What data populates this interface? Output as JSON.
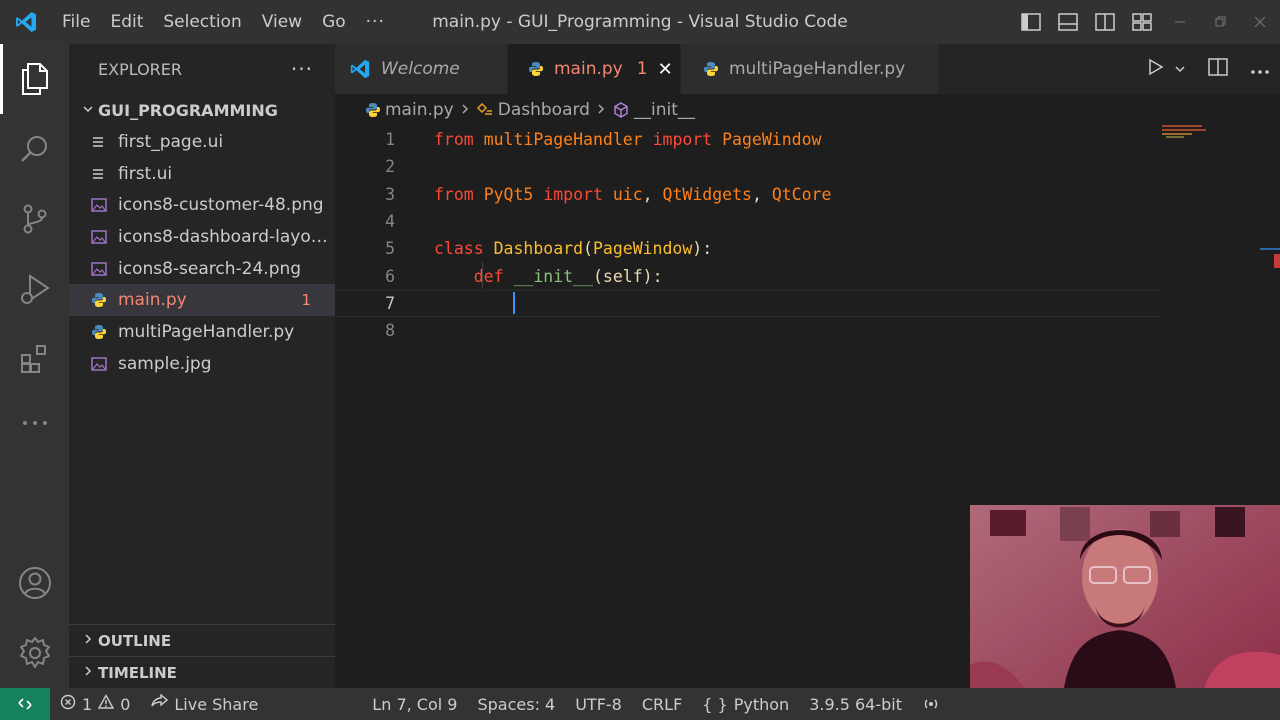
{
  "window": {
    "title": "main.py - GUI_Programming - Visual Studio Code"
  },
  "menu": {
    "items": [
      "File",
      "Edit",
      "Selection",
      "View",
      "Go"
    ],
    "more": "···"
  },
  "sidebar": {
    "header": "EXPLORER",
    "more": "···",
    "folder": "GUI_PROGRAMMING",
    "files": [
      {
        "name": "first_page.ui",
        "icon": "lines-icon"
      },
      {
        "name": "first.ui",
        "icon": "lines-icon"
      },
      {
        "name": "icons8-customer-48.png",
        "icon": "image-icon"
      },
      {
        "name": "icons8-dashboard-layou...",
        "icon": "image-icon"
      },
      {
        "name": "icons8-search-24.png",
        "icon": "image-icon"
      },
      {
        "name": "main.py",
        "icon": "python-icon",
        "badge": "1"
      },
      {
        "name": "multiPageHandler.py",
        "icon": "python-icon"
      },
      {
        "name": "sample.jpg",
        "icon": "image-icon"
      }
    ],
    "sections": [
      "OUTLINE",
      "TIMELINE"
    ]
  },
  "tabs": [
    {
      "label": "Welcome",
      "icon": "vscode-icon"
    },
    {
      "label": "main.py",
      "icon": "python-icon",
      "badge": "1",
      "close": "✕"
    },
    {
      "label": "multiPageHandler.py",
      "icon": "python-icon"
    }
  ],
  "breadcrumb": {
    "file": "main.py",
    "class": "Dashboard",
    "method": "__init__"
  },
  "code": {
    "line_numbers": [
      "1",
      "2",
      "3",
      "4",
      "5",
      "6",
      "7",
      "8"
    ],
    "line1": {
      "a": "from",
      "b": "multiPageHandler",
      "c": "import",
      "d": "PageWindow"
    },
    "line3": {
      "a": "from",
      "b": "PyQt5",
      "c": "import",
      "d": "uic",
      "e": "QtWidgets",
      "f": "QtCore"
    },
    "line5": {
      "a": "class",
      "b": "Dashboard",
      "c": "PageWindow"
    },
    "line6": {
      "a": "def",
      "b": "__init__",
      "c": "self"
    }
  },
  "status": {
    "errors": "1",
    "warnings": "0",
    "live_share": "Live Share",
    "position": "Ln 7, Col 9",
    "spaces": "Spaces: 4",
    "encoding": "UTF-8",
    "eol": "CRLF",
    "language": "Python",
    "interpreter": "3.9.5 64-bit"
  },
  "colors": {
    "accent": "#3794ff",
    "error": "#f48771",
    "status_remote": "#16825d"
  }
}
